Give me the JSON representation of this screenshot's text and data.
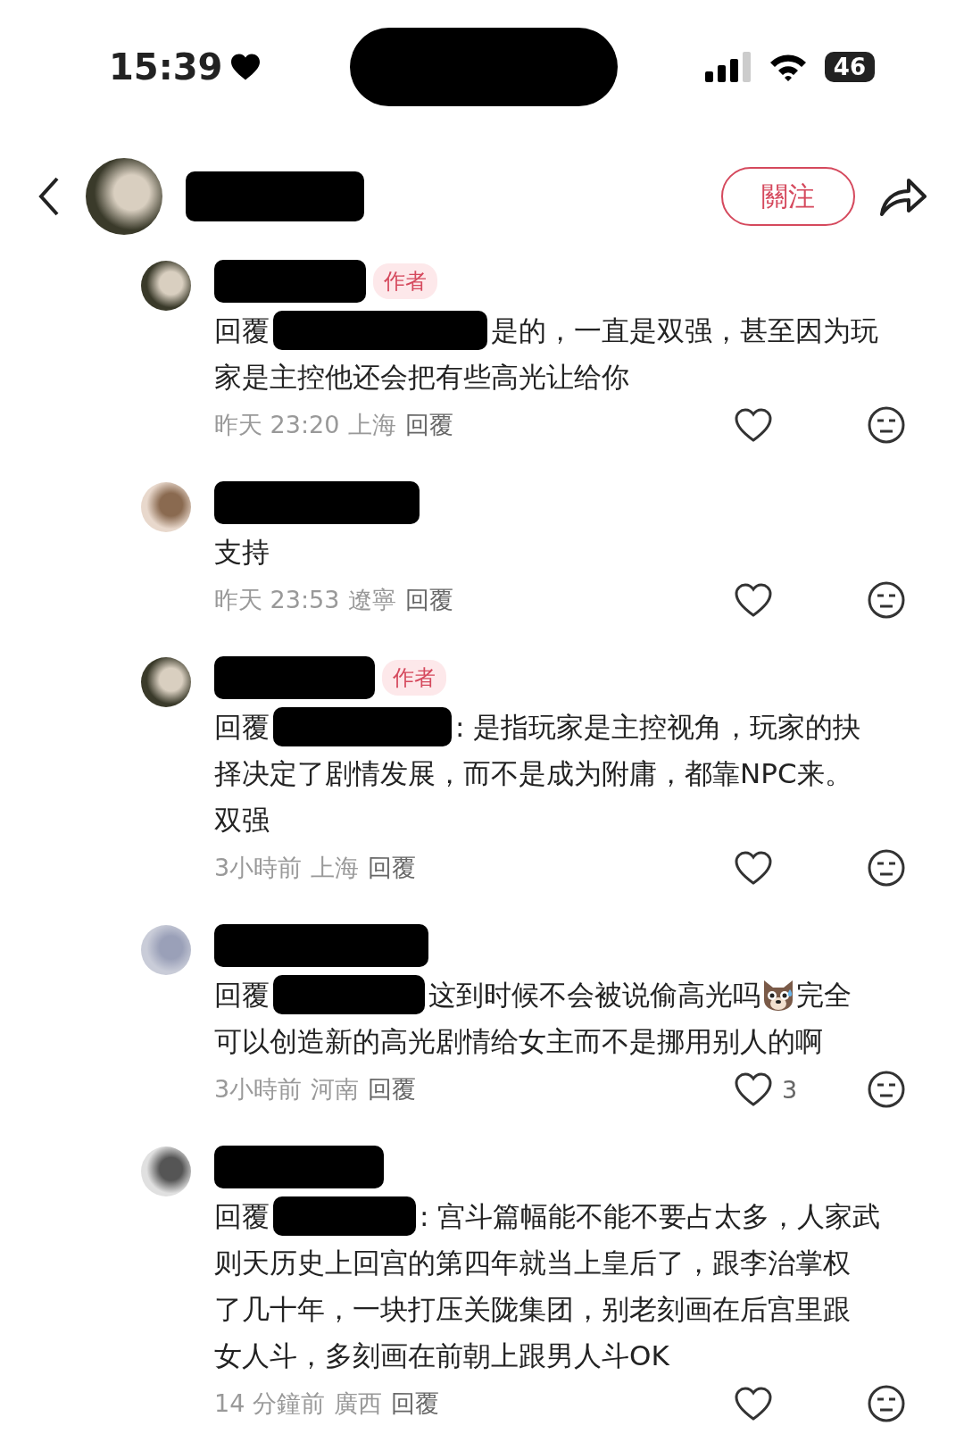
{
  "status_bar": {
    "time": "15:39",
    "battery": "46"
  },
  "header": {
    "follow_button": "關注"
  },
  "comments": [
    {
      "author_badge": "作者",
      "reply_prefix": "回覆",
      "lines": [
        "是的，一直是双强，甚至因为玩",
        "家是主控他还会把有些高光让给你"
      ],
      "time": "昨天 23:20",
      "location": "上海",
      "reply": "回覆"
    },
    {
      "lines": [
        "支持"
      ],
      "time": "昨天 23:53",
      "location": "遼寧",
      "reply": "回覆"
    },
    {
      "author_badge": "作者",
      "reply_prefix": "回覆",
      "lines": [
        ": 是指玩家是主控视角，玩家的抉",
        "择决定了剧情发展，而不是成为附庸，都靠NPC来。",
        "双强"
      ],
      "time": "3小時前",
      "location": "上海",
      "reply": "回覆"
    },
    {
      "reply_prefix": "回覆",
      "lines": [
        "这到时候不会被说偷高光吗",
        "可以创造新的高光剧情给女主而不是挪用别人的啊"
      ],
      "emoji": true,
      "after_emoji": "完全",
      "time": "3小時前",
      "location": "河南",
      "reply": "回覆",
      "likes": "3"
    },
    {
      "reply_prefix": "回覆",
      "lines": [
        ": 宫斗篇幅能不能不要占太多，人家武",
        "则天历史上回宫的第四年就当上皇后了，跟李治掌权",
        "了几十年，一块打压关陇集团，别老刻画在后宫里跟",
        "女人斗，多刻画在前朝上跟男人斗OK"
      ],
      "time": "14 分鐘前",
      "location": "廣西",
      "reply": "回覆"
    }
  ]
}
